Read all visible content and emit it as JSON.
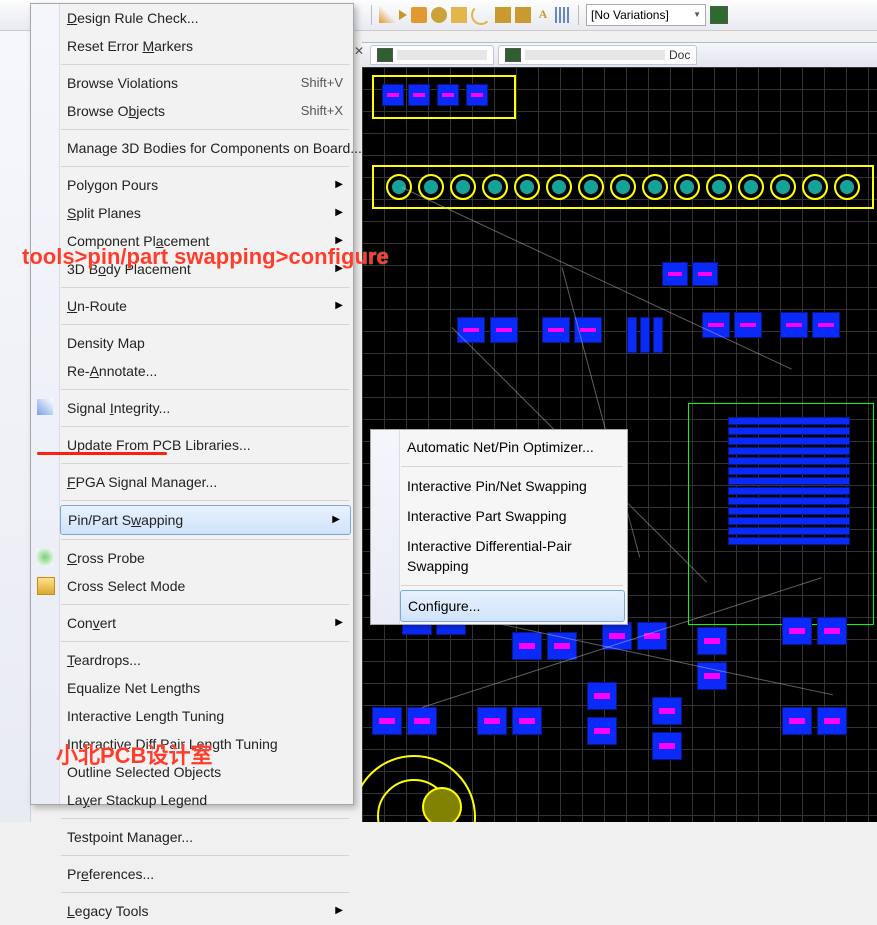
{
  "toolbar": {
    "variations_label": "[No Variations]"
  },
  "tabs": {
    "tab1_suffix": "",
    "tab2_suffix": "Doc"
  },
  "annotations": {
    "path_hint": "tools>pin/part swapping>configure",
    "watermark": "小北PCB设计室"
  },
  "shortcuts": {
    "browse_violations": "Shift+V",
    "browse_objects": "Shift+X"
  },
  "menu": {
    "design_rule_check": "Design Rule Check...",
    "reset_error_markers": "Reset Error Markers",
    "browse_violations": "Browse Violations",
    "browse_objects": "Browse Objects",
    "manage_3d_bodies": "Manage 3D Bodies for Components on Board...",
    "polygon_pours": "Polygon Pours",
    "split_planes": "Split Planes",
    "component_placement": "Component Placement",
    "body_placement_3d": "3D Body Placement",
    "un_route": "Un-Route",
    "density_map": "Density Map",
    "re_annotate": "Re-Annotate...",
    "signal_integrity": "Signal Integrity...",
    "update_from_pcb_libs": "Update From PCB Libraries...",
    "fpga_signal_manager": "FPGA Signal Manager...",
    "pin_part_swapping": "Pin/Part Swapping",
    "cross_probe": "Cross Probe",
    "cross_select_mode": "Cross Select Mode",
    "convert": "Convert",
    "teardrops": "Teardrops...",
    "equalize_net_lengths": "Equalize Net Lengths",
    "interactive_length_tuning": "Interactive Length Tuning",
    "interactive_diff_pair_tuning": "Interactive Diff Pair Length Tuning",
    "outline_selected_objects": "Outline Selected Objects",
    "layer_stackup_legend": "Layer Stackup Legend",
    "testpoint_manager": "Testpoint Manager...",
    "preferences": "Preferences...",
    "legacy_tools": "Legacy Tools"
  },
  "submenu": {
    "auto_optimizer": "Automatic Net/Pin Optimizer...",
    "interactive_pin_net": "Interactive Pin/Net Swapping",
    "interactive_part": "Interactive Part Swapping",
    "interactive_diff_pair": "Interactive Differential-Pair Swapping",
    "configure": "Configure..."
  }
}
